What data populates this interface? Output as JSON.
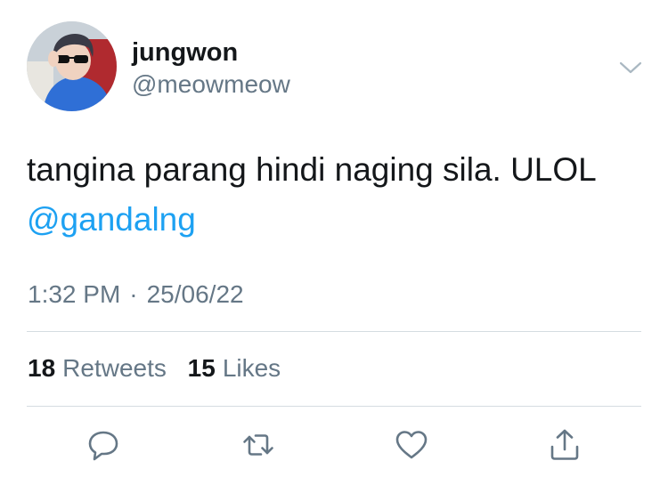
{
  "user": {
    "display_name": "jungwon",
    "handle": "@meowmeow"
  },
  "tweet": {
    "text": "tangina parang hindi naging sila. ULOL",
    "mention": "@gandalng"
  },
  "meta": {
    "time": "1:32 PM",
    "separator": "·",
    "date": "25/06/22"
  },
  "stats": {
    "retweets_count": "18",
    "retweets_label": "Retweets",
    "likes_count": "15",
    "likes_label": "Likes"
  },
  "icons": {
    "more": "chevron-down-icon",
    "reply": "reply-icon",
    "retweet": "retweet-icon",
    "like": "heart-icon",
    "share": "share-icon"
  },
  "colors": {
    "link": "#1da1f2",
    "secondary_text": "#657786",
    "primary_text": "#14171a",
    "icon": "#657786",
    "divider": "#d5dce1"
  }
}
